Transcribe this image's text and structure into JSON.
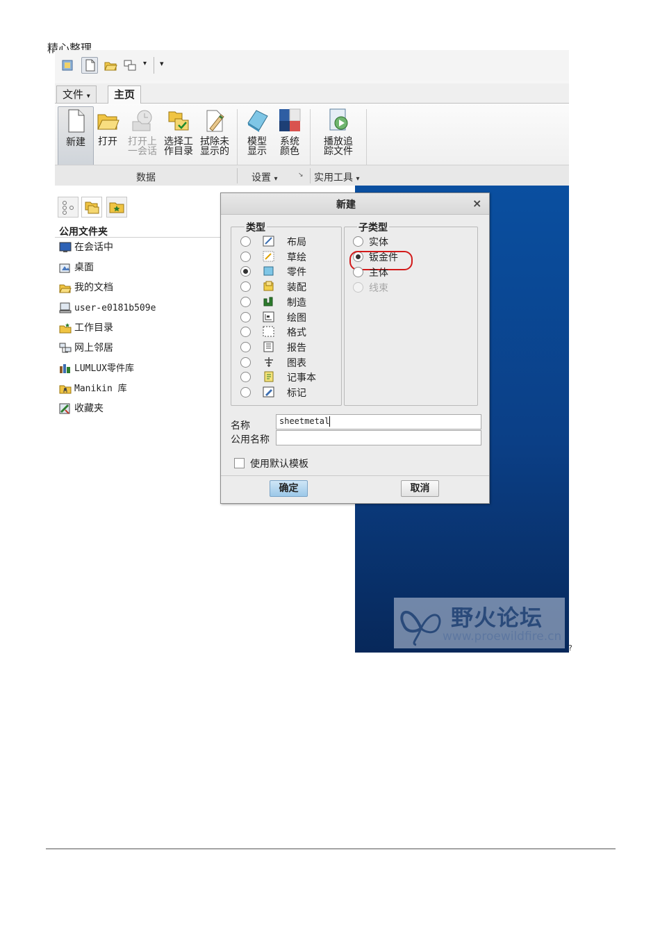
{
  "doc": {
    "header": "精心整理",
    "trailer": "?"
  },
  "tabs": {
    "file": "文件",
    "home": "主页"
  },
  "ribbon": {
    "buttons": [
      {
        "label": "新建",
        "state": "pressed"
      },
      {
        "label": "打开",
        "state": "normal"
      },
      {
        "label": "打开上\n一会话",
        "state": "disabled"
      },
      {
        "label": "选择工\n作目录",
        "state": "normal"
      },
      {
        "label": "拭除未\n显示的",
        "state": "normal"
      },
      {
        "label": "模型\n显示",
        "state": "normal"
      },
      {
        "label": "系统\n颜色",
        "state": "normal"
      },
      {
        "label": "播放追\n踪文件",
        "state": "normal"
      }
    ],
    "groups": {
      "data": "数据",
      "settings": "设置",
      "utilities": "实用工具"
    }
  },
  "panel": {
    "title": "公用文件夹",
    "items": [
      {
        "label": "在会话中"
      },
      {
        "label": "桌面"
      },
      {
        "label": "我的文档"
      },
      {
        "label": "user-e0181b509e"
      },
      {
        "label": "工作目录"
      },
      {
        "label": "网上邻居"
      },
      {
        "label": "LUMLUX零件库"
      },
      {
        "label": "Manikin 库"
      },
      {
        "label": "收藏夹"
      }
    ]
  },
  "dialog": {
    "title": "新建",
    "close": "×",
    "type_legend": "类型",
    "subtype_legend": "子类型",
    "types": [
      {
        "label": "布局",
        "selected": false
      },
      {
        "label": "草绘",
        "selected": false
      },
      {
        "label": "零件",
        "selected": true
      },
      {
        "label": "装配",
        "selected": false
      },
      {
        "label": "制造",
        "selected": false
      },
      {
        "label": "绘图",
        "selected": false
      },
      {
        "label": "格式",
        "selected": false
      },
      {
        "label": "报告",
        "selected": false
      },
      {
        "label": "图表",
        "selected": false
      },
      {
        "label": "记事本",
        "selected": false
      },
      {
        "label": "标记",
        "selected": false
      }
    ],
    "subtypes": [
      {
        "label": "实体",
        "selected": false,
        "disabled": false
      },
      {
        "label": "钣金件",
        "selected": true,
        "disabled": false
      },
      {
        "label": "主体",
        "selected": false,
        "disabled": false
      },
      {
        "label": "线束",
        "selected": false,
        "disabled": true
      }
    ],
    "name_label": "名称",
    "name_value": "sheetmetal",
    "common_name_label": "公用名称",
    "common_name_value": "",
    "default_template_label": "使用默认模板",
    "default_template_checked": false,
    "ok": "确定",
    "cancel": "取消"
  },
  "watermark": {
    "title": "野火论坛",
    "url": "www.proewildfire.cn"
  },
  "colors": {
    "graphics_bg": "#0b3f86",
    "highlight_ring": "#d21a1a",
    "ok_button": "#9cc8e8"
  }
}
